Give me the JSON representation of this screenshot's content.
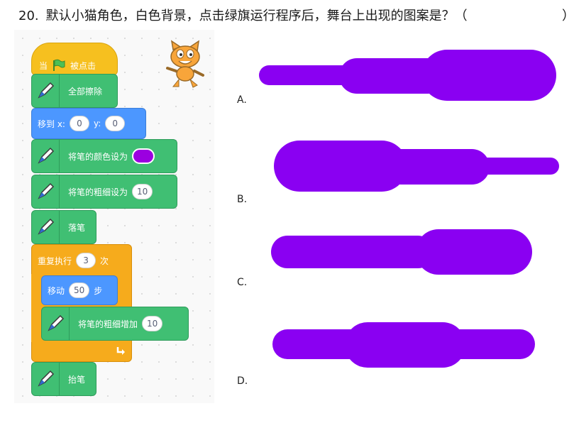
{
  "question": {
    "number": "20.",
    "text": "默认小猫角色，白色背景，点击绿旗运行程序后，舞台上出现的图案是？（",
    "close_paren": "）"
  },
  "script": {
    "hat": {
      "prefix": "当",
      "suffix": "被点击"
    },
    "clear_label": "全部擦除",
    "goto": {
      "label": "移到 x:",
      "x": "0",
      "y_label": "y:",
      "y": "0"
    },
    "set_color_label": "将笔的颜色设为",
    "set_size": {
      "label": "将笔的粗细设为",
      "value": "10"
    },
    "pen_down_label": "落笔",
    "repeat": {
      "label": "重复执行",
      "count": "3",
      "suffix": "次"
    },
    "move": {
      "label": "移动",
      "steps": "50",
      "suffix": "步"
    },
    "change_size": {
      "label": "将笔的粗细增加",
      "value": "10"
    },
    "pen_up_label": "抬笔"
  },
  "options": [
    {
      "label": "A."
    },
    {
      "label": "B."
    },
    {
      "label": "C."
    },
    {
      "label": "D."
    }
  ],
  "colors": {
    "pen_color": "#9b00e0",
    "shape_color": "#8a00f2",
    "hat_block": "#f6c01f",
    "pen_block": "#40bf73",
    "motion_block": "#4c97ff",
    "control_block": "#f6ab1c"
  },
  "icons": [
    "green-flag-icon",
    "pen-icon",
    "scratch-cat-icon",
    "loop-arrow-icon"
  ]
}
